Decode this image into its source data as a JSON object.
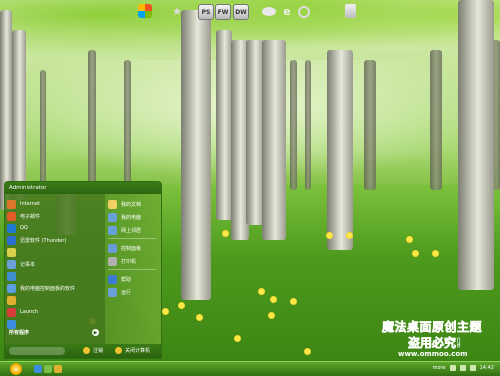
{
  "dock": {
    "icons": [
      {
        "name": "windows-flag-icon"
      },
      {
        "name": "star-icon"
      },
      {
        "name": "photoshop-icon",
        "label": "PS"
      },
      {
        "name": "fireworks-icon",
        "label": "FW"
      },
      {
        "name": "dreamweaver-icon",
        "label": "DW"
      },
      {
        "name": "cloud-icon"
      },
      {
        "name": "ie-icon"
      },
      {
        "name": "link-icon"
      },
      {
        "name": "recycle-bin-icon"
      }
    ]
  },
  "start_menu": {
    "user": "Administrator",
    "left_items": [
      {
        "label": "Internet",
        "color": "#3b7bd6"
      },
      {
        "label": "电子邮件",
        "color": "#e25a2a"
      },
      {
        "label": "QQ",
        "color": "#1f7ad1"
      },
      {
        "label": "迅雷软件 (Thunder)",
        "color": "#2b6fd1"
      },
      {
        "label": "",
        "color": "#d9d04a"
      },
      {
        "label": "记事本",
        "color": "#6aa0d8"
      },
      {
        "label": "",
        "color": "#3f8fcf"
      },
      {
        "label": "我的电脑控制面板的软件",
        "color": "#5aa0e0"
      },
      {
        "label": "",
        "color": "#e0b030"
      },
      {
        "label": "Launch",
        "color": "#d93b3b"
      },
      {
        "label": "",
        "color": "#3b8de0"
      }
    ],
    "all_programs": "所有程序",
    "right_items": [
      {
        "label": "我的文档",
        "color": "#f0d060"
      },
      {
        "label": "我的电脑",
        "color": "#6aa0d8"
      },
      {
        "label": "网上邻居",
        "color": "#6aa0d8"
      },
      {
        "label": "控制面板",
        "color": "#6a9ad8"
      },
      {
        "label": "打印机",
        "color": "#b0b0b0"
      },
      {
        "label": "帮助",
        "color": "#3b7bd6"
      },
      {
        "label": "运行",
        "color": "#6aa0d8"
      }
    ],
    "footer": {
      "logoff": "注销",
      "shutdown": "关闭计算机"
    }
  },
  "taskbar": {
    "quick_launch": [
      {
        "name": "ie-quick-icon",
        "color": "#3b8de0"
      },
      {
        "name": "desktop-quick-icon",
        "color": "#7ac04a"
      },
      {
        "name": "media-quick-icon",
        "color": "#e0b030"
      }
    ],
    "tray_text": "more",
    "clock": "14:42"
  },
  "watermark": {
    "line1": "魔法桌面原创主题",
    "line2": "盗用必究!",
    "line3": "www.ommoo.com"
  }
}
